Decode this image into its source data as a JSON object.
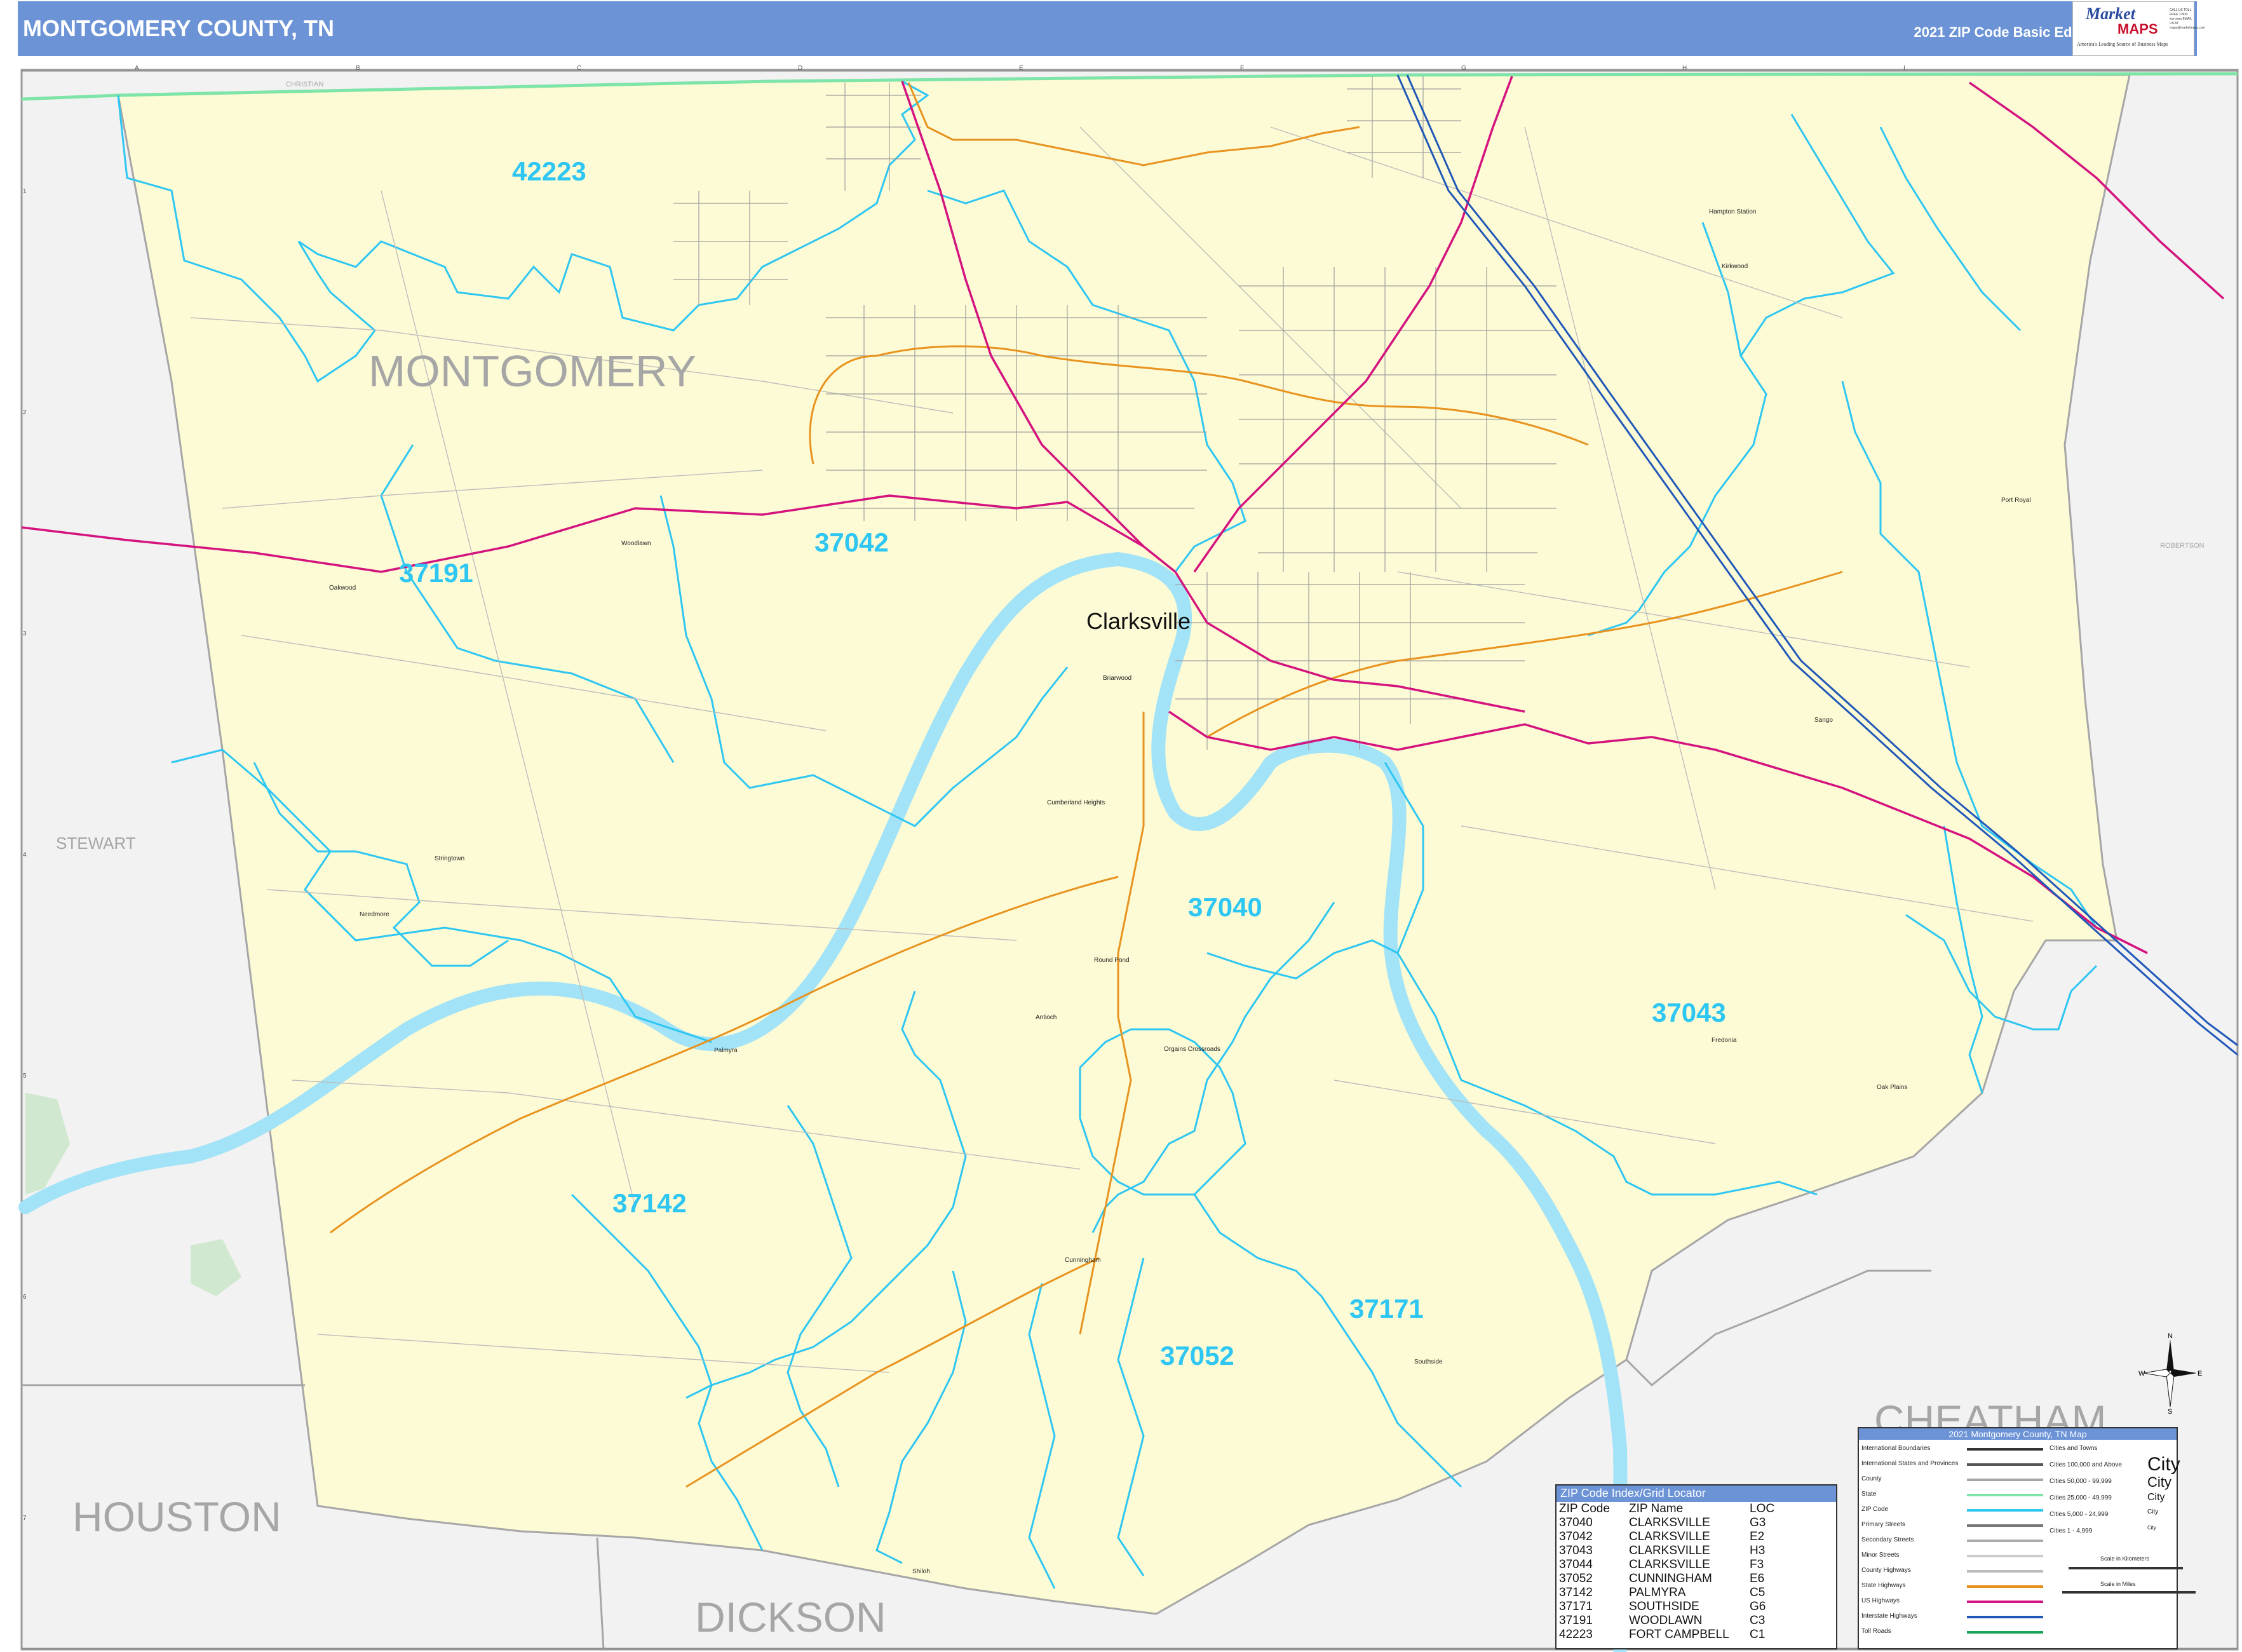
{
  "header": {
    "title": "MONTGOMERY COUNTY, TN",
    "edition": "2021 ZIP Code Basic Edition"
  },
  "logo": {
    "brand_top": "Market",
    "brand_bottom": "MAPS",
    "tagline": "America's Leading Source of Business Maps",
    "contact": "CALL US TOLL FREE 1-800-xxx-xxxx EMAIL US AT maps@marketmaps.com"
  },
  "colors": {
    "county_fill": "#fdfbd5",
    "outside_fill": "#f2f2f2",
    "zip_boundary": "#2ec6f2",
    "river": "#a3e3f7",
    "interstate": "#2158b8",
    "us_highway": "#d4137f",
    "state_highway": "#e8931f",
    "header": "#6b93d6"
  },
  "grid": {
    "columns": [
      "A",
      "B",
      "C",
      "D",
      "E",
      "F",
      "G",
      "H",
      "I"
    ],
    "rows": [
      "1",
      "2",
      "3",
      "4",
      "5",
      "6",
      "7"
    ]
  },
  "counties": {
    "main": "MONTGOMERY",
    "stewart": "STEWART",
    "houston": "HOUSTON",
    "dickson": "DICKSON",
    "cheatham": "CHEATHAM",
    "christian": "CHRISTIAN",
    "robertson": "ROBERTSON"
  },
  "zips": {
    "z42223": "42223",
    "z37042": "37042",
    "z37191": "37191",
    "z37040": "37040",
    "z37043": "37043",
    "z37142": "37142",
    "z37171": "37171",
    "z37052": "37052"
  },
  "cities": {
    "clarksville": "Clarksville",
    "hampton_station": "Hampton Station",
    "kirkwood": "Kirkwood",
    "port_royal": "Port Royal",
    "woodlawn": "Woodlawn",
    "oakwood": "Oakwood",
    "briarwood": "Briarwood",
    "sango": "Sango",
    "cumberland_heights": "Cumberland Heights",
    "slayden": "Stringtown",
    "needmore": "Needmore",
    "round_pond": "Round Pond",
    "antioch": "Antioch",
    "palmyra": "Palmyra",
    "orgains_crossroads": "Orgains Crossroads",
    "fredonia": "Fredonia",
    "oak_plains": "Oak Plains",
    "cunningham": "Cunningham",
    "southside": "Southside",
    "shiloh": "Shiloh"
  },
  "zip_index": {
    "title": "ZIP Code Index/Grid Locator",
    "headers": [
      "ZIP Code",
      "ZIP Name",
      "LOC"
    ],
    "rows": [
      [
        "37040",
        "CLARKSVILLE",
        "G3"
      ],
      [
        "37042",
        "CLARKSVILLE",
        "E2"
      ],
      [
        "37043",
        "CLARKSVILLE",
        "H3"
      ],
      [
        "37044",
        "CLARKSVILLE",
        "F3"
      ],
      [
        "37052",
        "CUNNINGHAM",
        "E6"
      ],
      [
        "37142",
        "PALMYRA",
        "C5"
      ],
      [
        "37171",
        "SOUTHSIDE",
        "G6"
      ],
      [
        "37191",
        "WOODLAWN",
        "C3"
      ],
      [
        "42223",
        "FORT CAMPBELL",
        "C1"
      ]
    ]
  },
  "legend": {
    "title": "2021 Montgomery County, TN Map",
    "rows": [
      "International Boundaries",
      "International States and Provinces",
      "County",
      "State",
      "ZIP Code",
      "Primary Streets",
      "Secondary Streets",
      "Minor Streets",
      "County Highways",
      "State Highways",
      "US Highways",
      "Interstate Highways",
      "Toll Roads"
    ],
    "city_classes": [
      "Cities and Towns",
      "Cities 100,000 and Above",
      "Cities 50,000 - 99,999",
      "Cities 25,000 - 49,999",
      "Cities 5,000 - 24,999",
      "Cities 1 - 4,999"
    ],
    "city_sample": "City",
    "scale_km": "Scale in Kilometers",
    "scale_mi": "Scale in Miles"
  },
  "compass": {
    "n": "N",
    "s": "S",
    "e": "E",
    "w": "W"
  }
}
